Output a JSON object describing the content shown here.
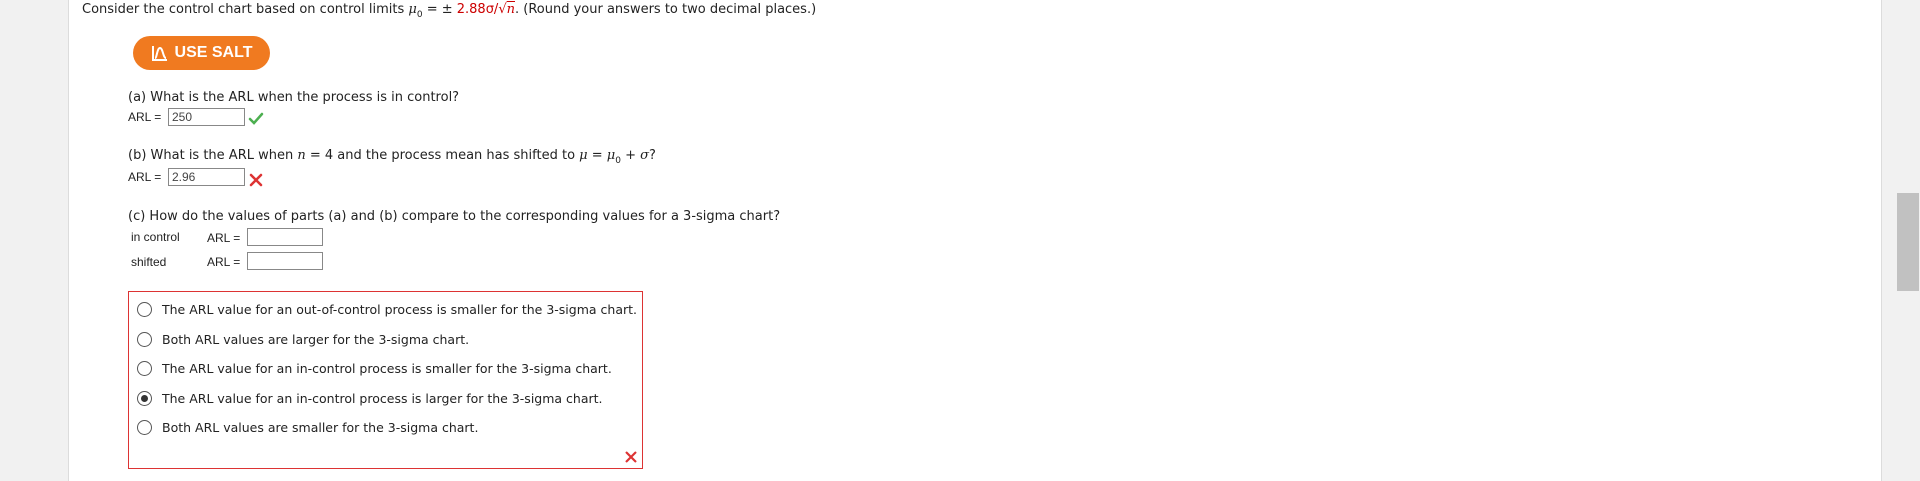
{
  "intro": {
    "prefix": "Consider the control chart based on control limits ",
    "mu": "μ",
    "mu_sub": "0",
    "equals": " = ± ",
    "limit_value": "2.88σ/",
    "root": "√",
    "n": "n",
    "suffix": ". (Round your answers to two decimal places.)"
  },
  "salt_button": {
    "label": "USE SALT",
    "icon": "salt-chart-icon"
  },
  "part_a": {
    "question": "(a) What is the ARL when the process is in control?",
    "label": "ARL =",
    "value": "250",
    "status": "correct"
  },
  "part_b": {
    "question_pre": "(b) What is the ARL when ",
    "n": "n",
    "mid": " = 4 and the process mean has shifted to ",
    "mu": "μ",
    "eq": " = ",
    "mu0": "μ",
    "sub0": "0",
    "plus": " + ",
    "sigma": "σ",
    "qmark": "?",
    "label": "ARL =",
    "value": "2.96",
    "status": "incorrect"
  },
  "part_c": {
    "question": "(c) How do the values of parts (a) and (b) compare to the corresponding values for a 3-sigma chart?",
    "rows": [
      {
        "name": "in control",
        "label": "ARL =",
        "value": ""
      },
      {
        "name": "shifted",
        "label": "ARL =",
        "value": ""
      }
    ],
    "options": [
      {
        "text": "The ARL value for an out-of-control process is smaller for the 3-sigma chart.",
        "selected": false
      },
      {
        "text": "Both ARL values are larger for the 3-sigma chart.",
        "selected": false
      },
      {
        "text": "The ARL value for an in-control process is smaller for the 3-sigma chart.",
        "selected": false
      },
      {
        "text": "The ARL value for an in-control process is larger for the 3-sigma chart.",
        "selected": true
      },
      {
        "text": "Both ARL values are smaller for the 3-sigma chart.",
        "selected": false
      }
    ],
    "status": "incorrect"
  },
  "colors": {
    "accent": "#f07a20",
    "error": "#dd3333",
    "correct": "#4caf50"
  }
}
